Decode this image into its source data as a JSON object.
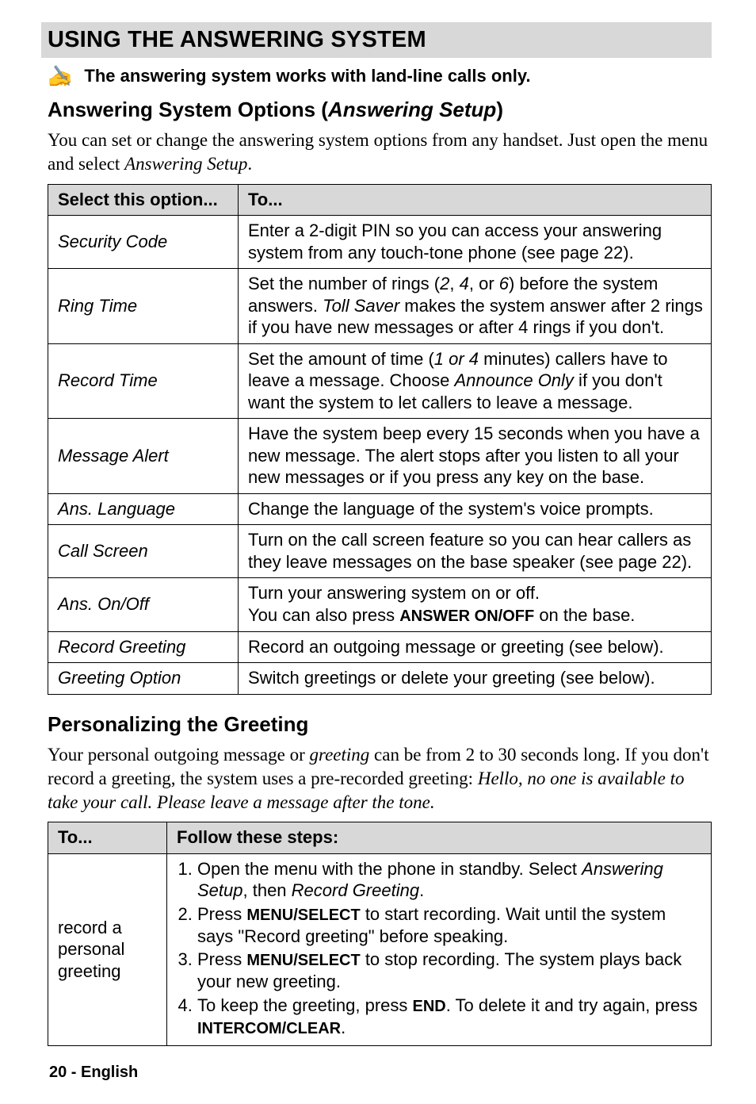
{
  "title": "USING THE ANSWERING SYSTEM",
  "note": "The answering system works with land-line calls only.",
  "section1": {
    "heading_pre": "Answering System Options (",
    "heading_ital": "Answering Setup",
    "heading_post": ")",
    "para_pre": "You can set or change the answering system options from any handset. Just open the menu and select ",
    "para_ital": "Answering Setup",
    "para_post": ".",
    "th1": "Select this option...",
    "th2": "To...",
    "rows": [
      {
        "opt": "Security Code",
        "parts": [
          {
            "t": "Enter a 2-digit PIN so you can access your answering system from any touch-tone phone (see page 22)."
          }
        ]
      },
      {
        "opt": "Ring Time",
        "parts": [
          {
            "t": "Set the number of rings ("
          },
          {
            "t": "2",
            "cls": "ital"
          },
          {
            "t": ", "
          },
          {
            "t": "4",
            "cls": "ital"
          },
          {
            "t": ", or "
          },
          {
            "t": "6",
            "cls": "ital"
          },
          {
            "t": ") before the system answers. "
          },
          {
            "t": "Toll Saver",
            "cls": "ital"
          },
          {
            "t": " makes the system answer after 2 rings if you have new messages or after 4 rings if you don't."
          }
        ]
      },
      {
        "opt": "Record Time",
        "parts": [
          {
            "t": "Set the amount of time ("
          },
          {
            "t": "1 or 4",
            "cls": "ital"
          },
          {
            "t": " minutes) callers have to leave a message. Choose "
          },
          {
            "t": "Announce Only",
            "cls": "ital"
          },
          {
            "t": " if you don't want the system to let callers to leave a message."
          }
        ]
      },
      {
        "opt": "Message Alert",
        "parts": [
          {
            "t": "Have the system beep every 15 seconds when you have a new message. The alert stops after you listen to all your new messages or if you press any key on the base."
          }
        ]
      },
      {
        "opt": "Ans. Language",
        "parts": [
          {
            "t": "Change the language of the system's voice prompts."
          }
        ]
      },
      {
        "opt": "Call Screen",
        "parts": [
          {
            "t": "Turn on the call screen feature so you can hear callers as they leave messages on the base speaker (see page 22)."
          }
        ]
      },
      {
        "opt": "Ans. On/Off",
        "parts": [
          {
            "t": "Turn your answering system on or off."
          },
          {
            "br": true
          },
          {
            "t": "You can also press "
          },
          {
            "t": "ANSWER ON/OFF",
            "cls": "keycap"
          },
          {
            "t": " on the base."
          }
        ]
      },
      {
        "opt": "Record Greeting",
        "parts": [
          {
            "t": "Record an outgoing message or greeting (see below)."
          }
        ]
      },
      {
        "opt": "Greeting Option",
        "parts": [
          {
            "t": "Switch greetings or delete your greeting (see below)."
          }
        ]
      }
    ]
  },
  "section2": {
    "heading": "Personalizing the Greeting",
    "para_parts": [
      {
        "t": "Your personal outgoing message or "
      },
      {
        "t": "greeting",
        "cls": "ital"
      },
      {
        "t": " can be from 2 to 30 seconds long. If you don't record a greeting, the system uses a pre-recorded greeting: "
      },
      {
        "t": "Hello, no one is available to take your call. Please leave a message after the tone.",
        "cls": "ital"
      }
    ],
    "th1": "To...",
    "th2": "Follow these steps:",
    "row": {
      "label": "record a personal greeting",
      "steps": [
        [
          {
            "t": "Open the menu with the phone in standby. Select "
          },
          {
            "t": "Answering Setup",
            "cls": "ital"
          },
          {
            "t": ", then "
          },
          {
            "t": "Record Greeting",
            "cls": "ital"
          },
          {
            "t": "."
          }
        ],
        [
          {
            "t": "Press "
          },
          {
            "t": "MENU/SELECT",
            "cls": "keycap"
          },
          {
            "t": " to start recording. Wait until the system says \"Record greeting\" before speaking."
          }
        ],
        [
          {
            "t": "Press "
          },
          {
            "t": "MENU/SELECT",
            "cls": "keycap"
          },
          {
            "t": " to stop recording. The system plays back your new greeting."
          }
        ],
        [
          {
            "t": "To keep the greeting, press "
          },
          {
            "t": "END",
            "cls": "keycap"
          },
          {
            "t": ". To delete it and try again, press "
          },
          {
            "t": "INTERCOM/CLEAR",
            "cls": "keycap"
          },
          {
            "t": "."
          }
        ]
      ]
    }
  },
  "footer": "20 - English"
}
